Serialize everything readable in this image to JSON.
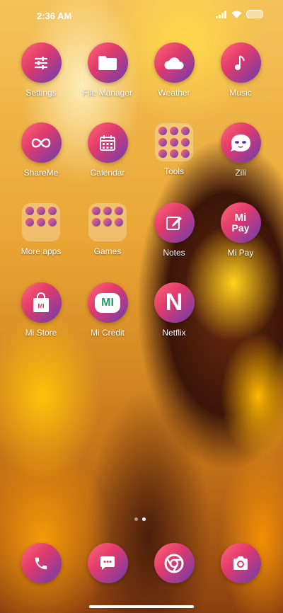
{
  "status_bar": {
    "time": "2:36 AM"
  },
  "apps": [
    {
      "label": "Settings",
      "icon": "sliders-icon"
    },
    {
      "label": "File Manager",
      "icon": "folder-icon"
    },
    {
      "label": "Weather",
      "icon": "cloud-icon"
    },
    {
      "label": "Music",
      "icon": "music-note-icon"
    },
    {
      "label": "ShareMe",
      "icon": "infinity-icon"
    },
    {
      "label": "Calendar",
      "icon": "calendar-icon"
    },
    {
      "label": "Tools",
      "icon": "folder-grid-icon"
    },
    {
      "label": "Zili",
      "icon": "zili-face-icon"
    },
    {
      "label": "More apps",
      "icon": "folder-grid-icon"
    },
    {
      "label": "Games",
      "icon": "folder-grid-icon"
    },
    {
      "label": "Notes",
      "icon": "note-edit-icon"
    },
    {
      "label": "Mi Pay",
      "icon": "mi-pay-icon",
      "icon_text_1": "Mi",
      "icon_text_2": "Pay"
    },
    {
      "label": "Mi Store",
      "icon": "shopping-bag-icon",
      "icon_text": "MI"
    },
    {
      "label": "Mi Credit",
      "icon": "mi-credit-icon",
      "icon_text": "MI"
    },
    {
      "label": "Netflix",
      "icon": "netflix-icon",
      "icon_text": "N"
    }
  ],
  "dock": [
    {
      "icon": "phone-icon"
    },
    {
      "icon": "messages-icon"
    },
    {
      "icon": "chrome-icon"
    },
    {
      "icon": "camera-icon"
    }
  ],
  "page_indicator": {
    "pages": 2,
    "current": 2
  },
  "colors": {
    "icon_gradient_start": "#ff6a7a",
    "icon_gradient_end": "#6a3cb0"
  }
}
